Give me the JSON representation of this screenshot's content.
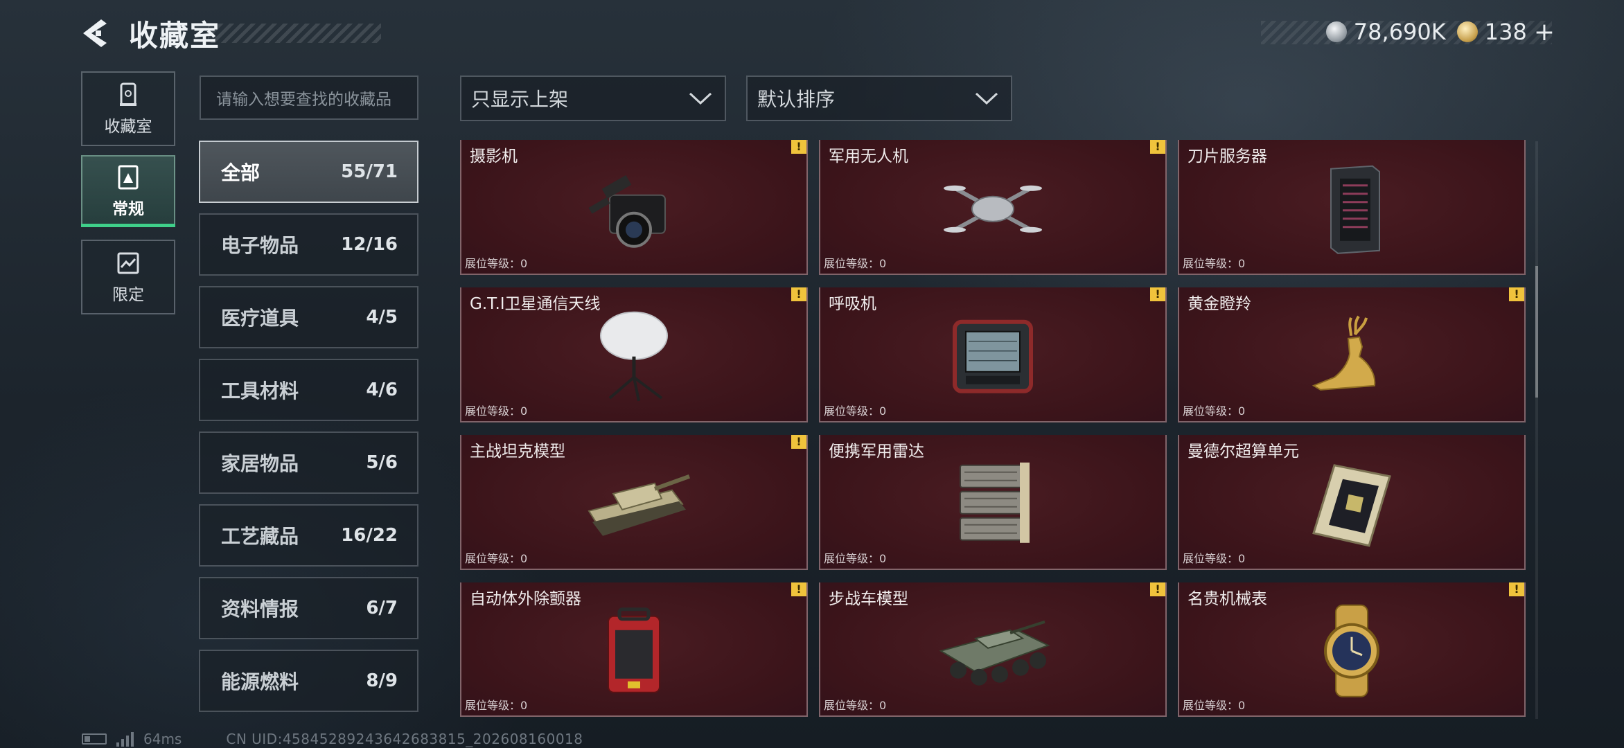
{
  "header": {
    "title": "收藏室",
    "currencies": [
      {
        "icon": "silver-coin-icon",
        "value": "78,690K"
      },
      {
        "icon": "gold-coin-icon",
        "value": "138"
      }
    ],
    "add_symbol": "+"
  },
  "nav_tabs": [
    {
      "label": "收藏室",
      "icon": "collection-room-icon",
      "active": false
    },
    {
      "label": "常规",
      "icon": "regular-icon",
      "active": true
    },
    {
      "label": "限定",
      "icon": "limited-icon",
      "active": false
    }
  ],
  "search": {
    "placeholder": "请输入想要查找的收藏品"
  },
  "filters": {
    "display_filter": "只显示上架",
    "sort": "默认排序"
  },
  "categories": [
    {
      "label": "全部",
      "count": "55/71",
      "active": true
    },
    {
      "label": "电子物品",
      "count": "12/16"
    },
    {
      "label": "医疗道具",
      "count": "4/5"
    },
    {
      "label": "工具材料",
      "count": "4/6"
    },
    {
      "label": "家居物品",
      "count": "5/6"
    },
    {
      "label": "工艺藏品",
      "count": "16/22"
    },
    {
      "label": "资料情报",
      "count": "6/7"
    },
    {
      "label": "能源燃料",
      "count": "8/9"
    }
  ],
  "items": [
    {
      "name": "摄影机",
      "level": "展位等级：0",
      "icon": "camera-icon",
      "warning": "!"
    },
    {
      "name": "军用无人机",
      "level": "展位等级：0",
      "icon": "drone-icon",
      "warning": "!"
    },
    {
      "name": "刀片服务器",
      "level": "展位等级：0",
      "icon": "server-icon",
      "warning": ""
    },
    {
      "name": "G.T.I卫星通信天线",
      "level": "展位等级：0",
      "icon": "satellite-antenna-icon",
      "warning": "!"
    },
    {
      "name": "呼吸机",
      "level": "展位等级：0",
      "icon": "ventilator-icon",
      "warning": "!"
    },
    {
      "name": "黄金瞪羚",
      "level": "展位等级：0",
      "icon": "gold-gazelle-icon",
      "warning": "!"
    },
    {
      "name": "主战坦克模型",
      "level": "展位等级：0",
      "icon": "tank-model-icon",
      "warning": "!"
    },
    {
      "name": "便携军用雷达",
      "level": "展位等级：0",
      "icon": "radar-icon",
      "warning": ""
    },
    {
      "name": "曼德尔超算单元",
      "level": "展位等级：0",
      "icon": "supercomputer-unit-icon",
      "warning": ""
    },
    {
      "name": "自动体外除颤器",
      "level": "展位等级：0",
      "icon": "defibrillator-icon",
      "warning": "!"
    },
    {
      "name": "步战车模型",
      "level": "展位等级：0",
      "icon": "ifv-model-icon",
      "warning": "!"
    },
    {
      "name": "名贵机械表",
      "level": "展位等级：0",
      "icon": "luxury-watch-icon",
      "warning": "!"
    }
  ],
  "footer": {
    "ping": "64ms",
    "uid": "CN UID:45845289243642683815_202608160018"
  }
}
